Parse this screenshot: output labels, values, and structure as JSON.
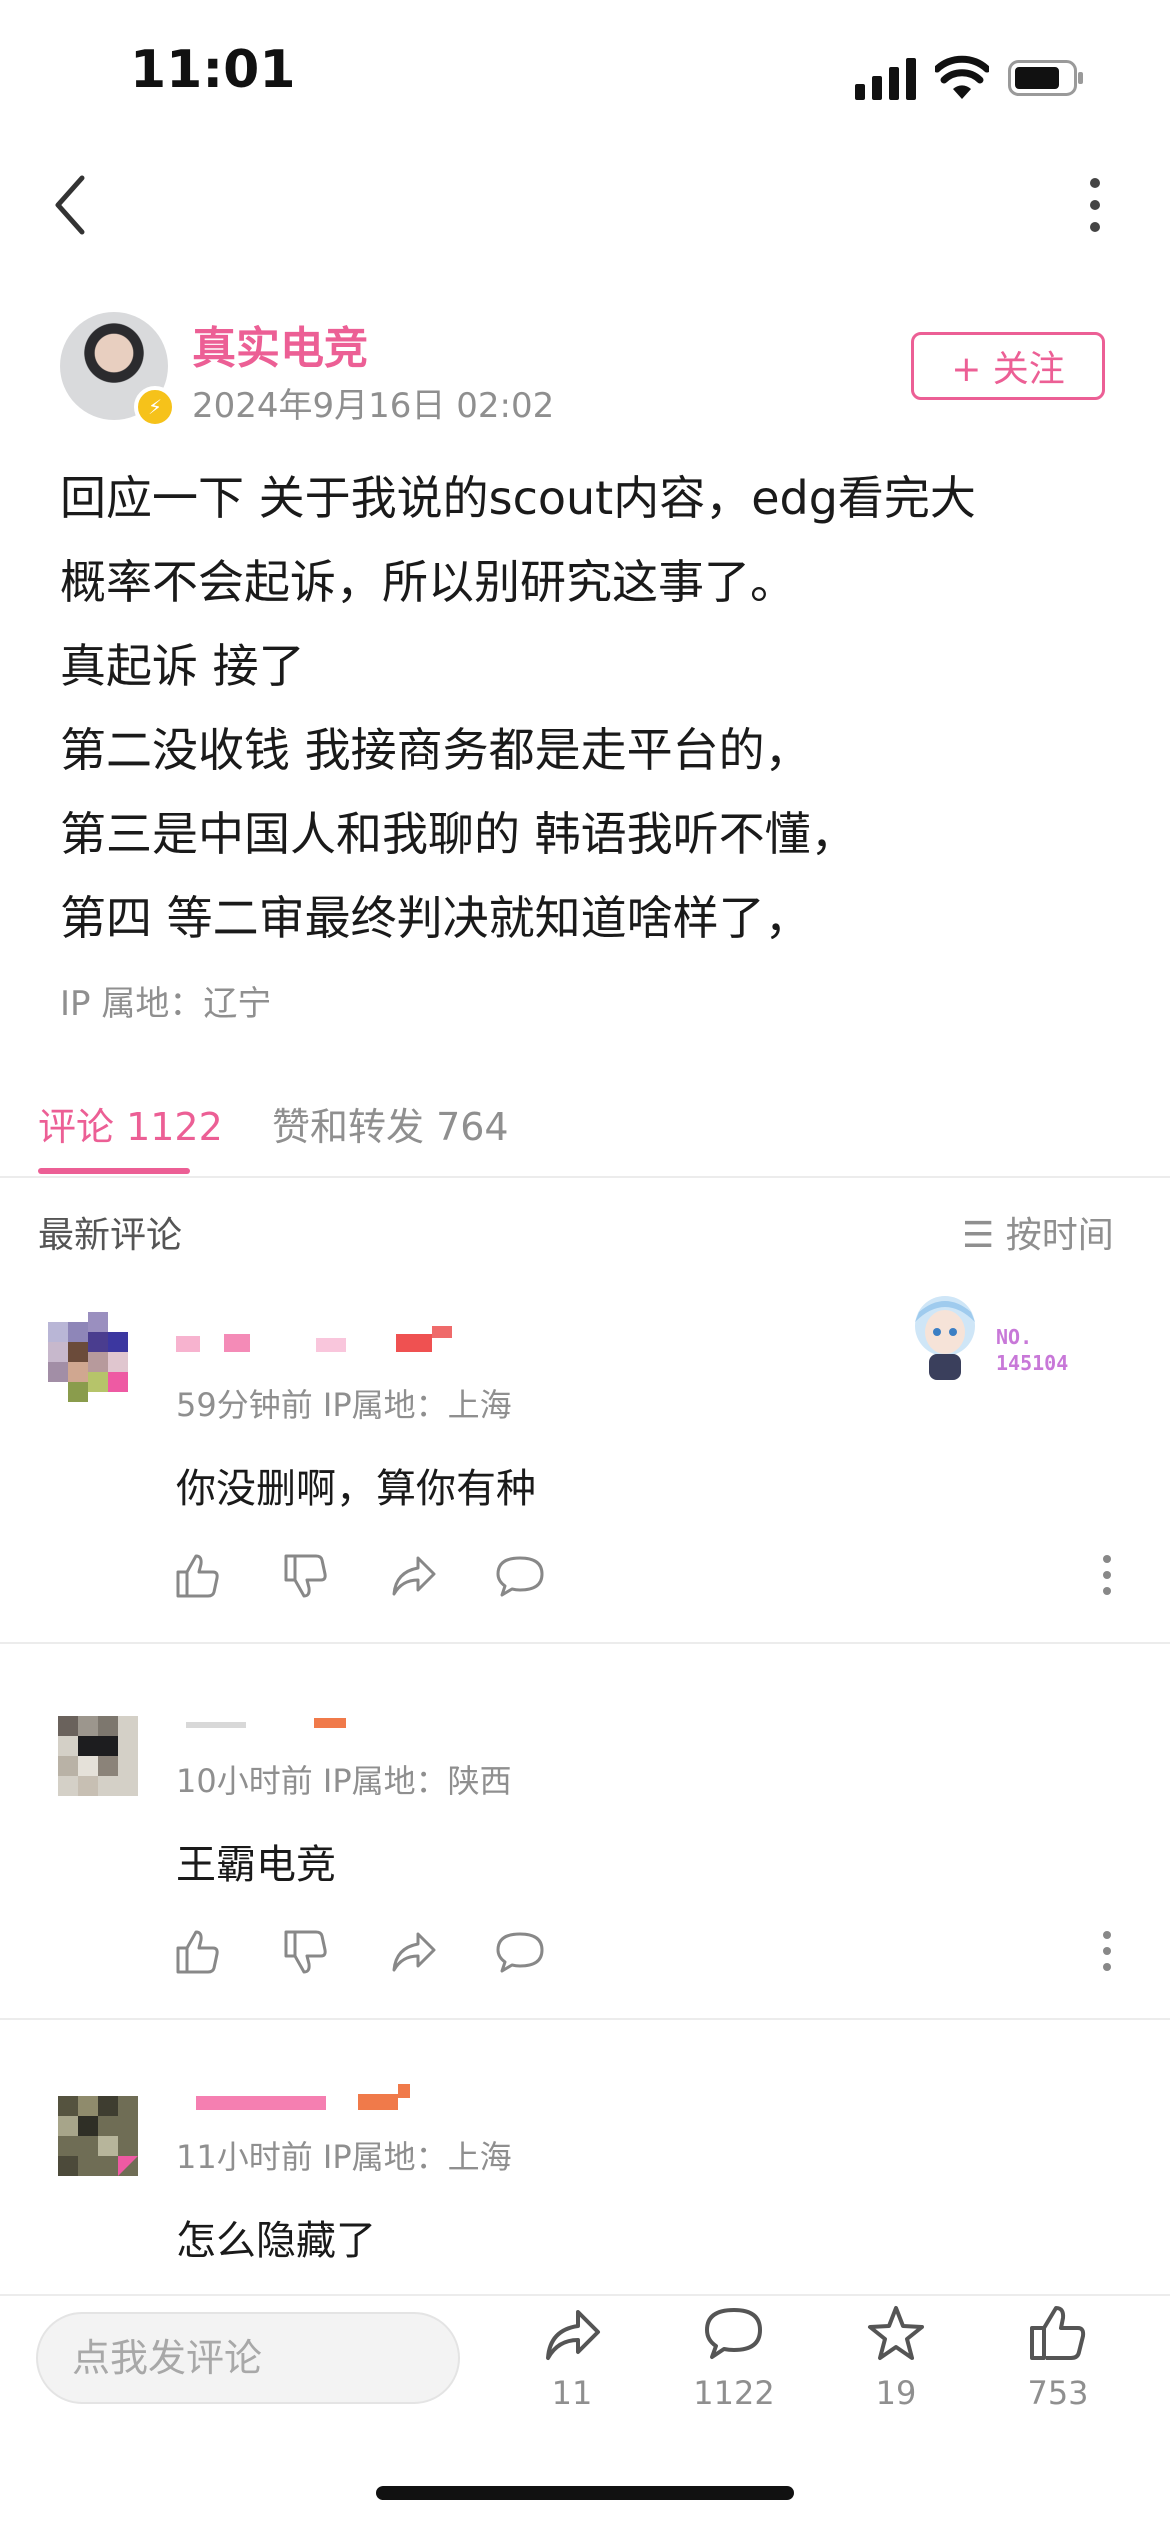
{
  "status": {
    "time": "11:01"
  },
  "post": {
    "author": "真实电竞",
    "date": "2024年9月16日 02:02",
    "follow_label": "+ 关注",
    "lines": [
      "回应一下 关于我说的scout内容，edg看完大",
      "概率不会起诉，所以别研究这事了。",
      "真起诉 接了",
      "第二没收钱  我接商务都是走平台的，",
      "第三是中国人和我聊的  韩语我听不懂，",
      "第四 等二审最终判决就知道啥样了，"
    ],
    "ip": "IP 属地：辽宁"
  },
  "tabs": {
    "comments": "评论 1122",
    "likes_reposts": "赞和转发 764"
  },
  "comments_header": {
    "title": "最新评论",
    "sort": "按时间"
  },
  "badge": {
    "no_label": "NO.",
    "no_value": "145104"
  },
  "comments": [
    {
      "meta": "59分钟前  IP属地：上海",
      "text": "你没删啊，算你有种"
    },
    {
      "meta": "10小时前  IP属地：陕西",
      "text": "王霸电竞"
    },
    {
      "meta": "11小时前  IP属地：上海",
      "text": "怎么隐藏了"
    }
  ],
  "bottom": {
    "input_placeholder": "点我发评论",
    "repost_count": "11",
    "comment_count": "1122",
    "favorite_count": "19",
    "like_count": "753"
  },
  "colors": {
    "accent": "#ec5f95",
    "muted": "#8f8f8f"
  }
}
